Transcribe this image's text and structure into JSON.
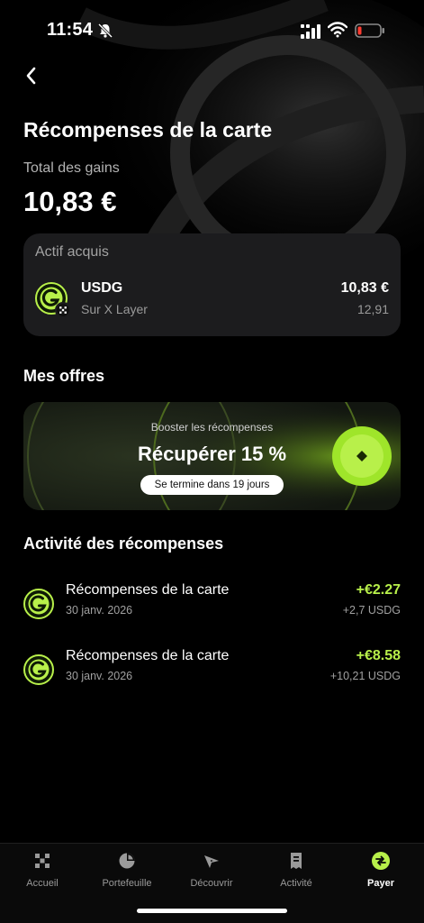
{
  "status_bar": {
    "time": "11:54"
  },
  "header": {
    "title": "Récompenses de la carte"
  },
  "summary": {
    "label": "Total des gains",
    "value": "10,83 €"
  },
  "asset_card": {
    "header": "Actif acquis",
    "name": "USDG",
    "network": "Sur X Layer",
    "value": "10,83 €",
    "quantity": "12,91"
  },
  "offers": {
    "title": "Mes offres",
    "card": {
      "kicker": "Booster les récompenses",
      "title": "Récupérer 15 %",
      "pill": "Se termine dans 19 jours"
    }
  },
  "activity": {
    "title": "Activité des récompenses",
    "items": [
      {
        "title": "Récompenses de la carte",
        "date": "30 janv. 2026",
        "amount": "+€2.27",
        "sub": "+2,7 USDG"
      },
      {
        "title": "Récompenses de la carte",
        "date": "30 janv. 2026",
        "amount": "+€8.58",
        "sub": "+10,21 USDG"
      }
    ]
  },
  "tabs": [
    {
      "label": "Accueil",
      "icon": "grid-icon"
    },
    {
      "label": "Portefeuille",
      "icon": "pie-chart-icon"
    },
    {
      "label": "Découvrir",
      "icon": "compass-icon"
    },
    {
      "label": "Activité",
      "icon": "receipt-icon"
    },
    {
      "label": "Payer",
      "icon": "pay-icon",
      "active": true
    }
  ],
  "colors": {
    "accent": "#b8f04a",
    "card": "#1c1c1e",
    "background": "#000000"
  }
}
